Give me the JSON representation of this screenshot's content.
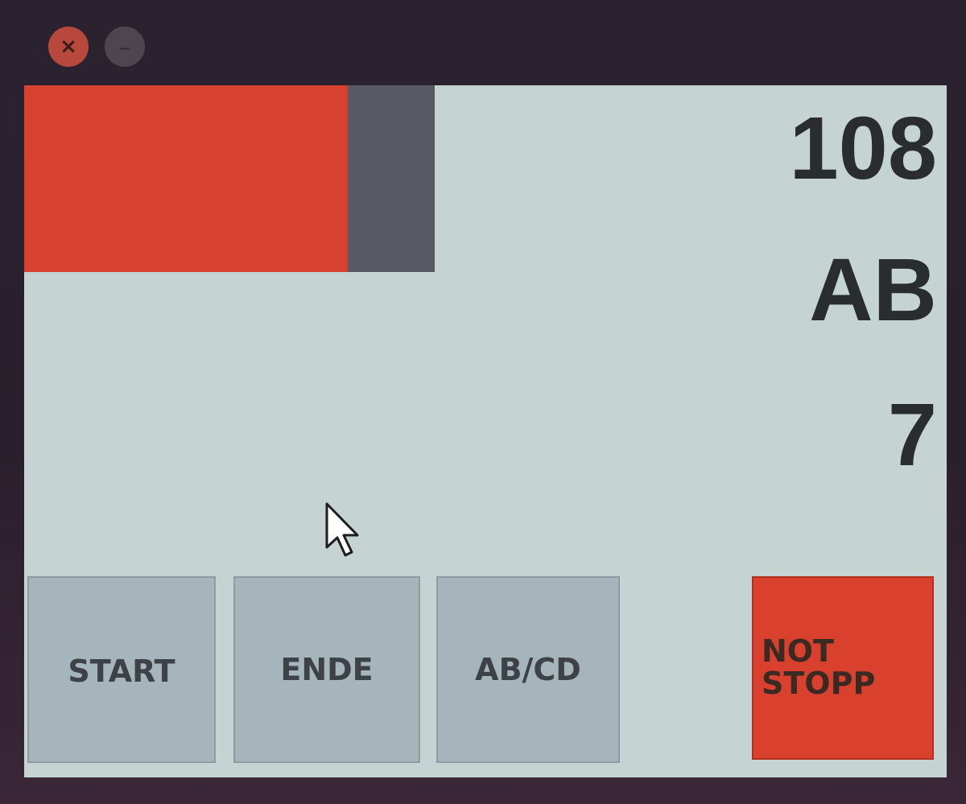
{
  "window": {
    "close_glyph": "×",
    "minimize_glyph": "–"
  },
  "status": {
    "indicator_color": "#d8412f",
    "secondary_color": "#575a62"
  },
  "readouts": {
    "value_1": "108",
    "value_2": "AB",
    "value_3": "7"
  },
  "buttons": {
    "start_label": "START",
    "ende_label": "ENDE",
    "abcd_label": "AB/CD",
    "notstopp_line1": "NOT",
    "notstopp_line2": "STOPP"
  },
  "colors": {
    "panel_bg": "#c5d4d2",
    "button_bg": "#a6b4bb",
    "emergency_bg": "#d9402e"
  }
}
